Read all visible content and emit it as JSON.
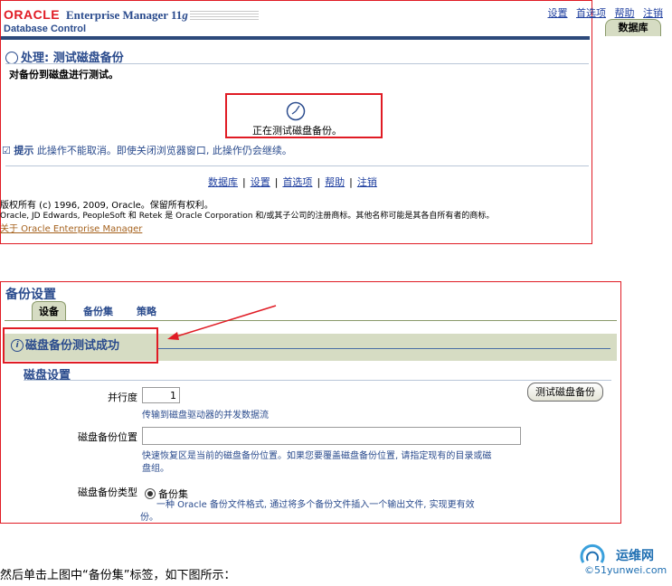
{
  "top_panel": {
    "brand_oracle": "ORACLE",
    "brand_product": "Enterprise Manager 11",
    "brand_version": "g",
    "brand_sub": "Database Control",
    "top_links": [
      "设置",
      "首选项",
      "帮助",
      "注销"
    ],
    "database_tab": "数据库",
    "page_title": "处理: 测试磁盘备份",
    "page_subtitle": "对备份到磁盘进行测试。",
    "progress_text": "正在测试磁盘备份。",
    "tip_label": "提示",
    "tip_text": "此操作不能取消。即使关闭浏览器窗口, 此操作仍会继续。",
    "footer_links": [
      "数据库",
      "设置",
      "首选项",
      "帮助",
      "注销"
    ],
    "copyright_1": "版权所有 (c) 1996, 2009, Oracle。保留所有权利。",
    "copyright_2": "Oracle, JD Edwards, PeopleSoft 和  Retek 是  Oracle Corporation 和/或其子公司的注册商标。其他名称可能是其各自所有者的商标。",
    "about_link": "关于  Oracle Enterprise Manager"
  },
  "bottom_panel": {
    "title": "备份设置",
    "tabs": [
      {
        "label": "设备",
        "active": true
      },
      {
        "label": "备份集",
        "active": false
      },
      {
        "label": "策略",
        "active": false
      }
    ],
    "success_message": "磁盘备份测试成功",
    "section_title": "磁盘设置",
    "parallelism_label": "并行度",
    "parallelism_value": "1",
    "parallelism_hint": "传输到磁盘驱动器的并发数据流",
    "location_label": "磁盘备份位置",
    "location_value": "",
    "location_hint_1": "快速恢复区是当前的磁盘备份位置。如果您要覆盖磁盘备份位置, 请指定现有的目录或磁",
    "location_hint_2": "盘组。",
    "type_label": "磁盘备份类型",
    "type_option": "备份集",
    "type_hint_1": "一种  Oracle 备份文件格式, 通过将多个备份文件插入一个输出文件, 实现更有效",
    "type_hint_2": "份。",
    "test_button": "测试磁盘备份"
  },
  "caption": "然后单击上图中“备份集”标签，如下图所示：",
  "watermark": {
    "line1": "运维网",
    "line2": "©51yunwei.com"
  },
  "colors": {
    "highlight_box": "#e01b24",
    "brand_blue": "#2a4b8d",
    "tab_green": "#d6dcc3",
    "oracle_red": "#e01b24"
  }
}
